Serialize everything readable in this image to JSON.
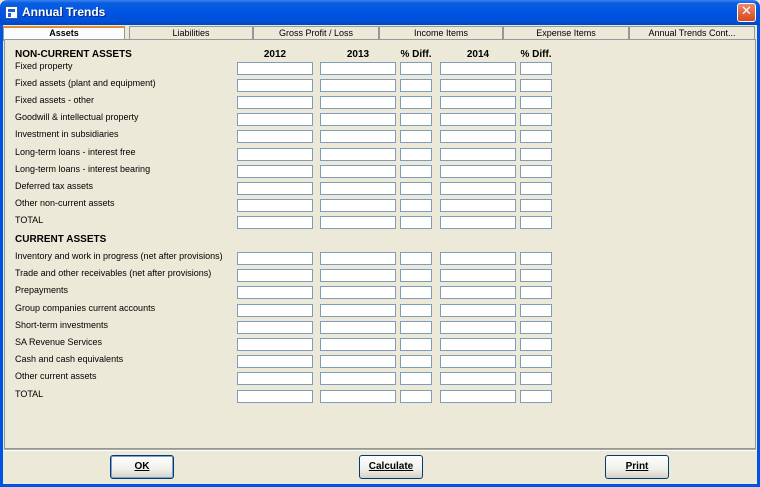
{
  "window": {
    "title": "Annual Trends",
    "close_label": "✕"
  },
  "tabs": [
    {
      "label": "Assets",
      "active": true
    },
    {
      "label": "Liabilities",
      "active": false
    },
    {
      "label": "Gross Profit / Loss",
      "active": false
    },
    {
      "label": "Income Items",
      "active": false
    },
    {
      "label": "Expense Items",
      "active": false
    },
    {
      "label": "Annual Trends Cont...",
      "active": false
    }
  ],
  "columns": [
    "2012",
    "2013",
    "% Diff.",
    "2014",
    "% Diff."
  ],
  "non_current": {
    "heading": "NON-CURRENT ASSETS",
    "rows": [
      "Fixed property",
      "Fixed assets (plant and equipment)",
      "Fixed assets - other",
      "Goodwill & intellectual property",
      "Investment in subsidiaries",
      "Long-term loans - interest free",
      "Long-term loans - interest bearing",
      "Deferred tax assets",
      "Other non-current assets",
      "TOTAL"
    ]
  },
  "current": {
    "heading": "CURRENT ASSETS",
    "rows": [
      "Inventory and work in progress (net after provisions)",
      "Trade and other receivables (net after provisions)",
      "Prepayments",
      "Group companies current accounts",
      "Short-term investments",
      "SA Revenue Services",
      "Cash and cash equivalents",
      "Other current assets",
      "TOTAL"
    ]
  },
  "buttons": {
    "ok": "OK",
    "calculate": "Calculate",
    "print": "Print"
  }
}
